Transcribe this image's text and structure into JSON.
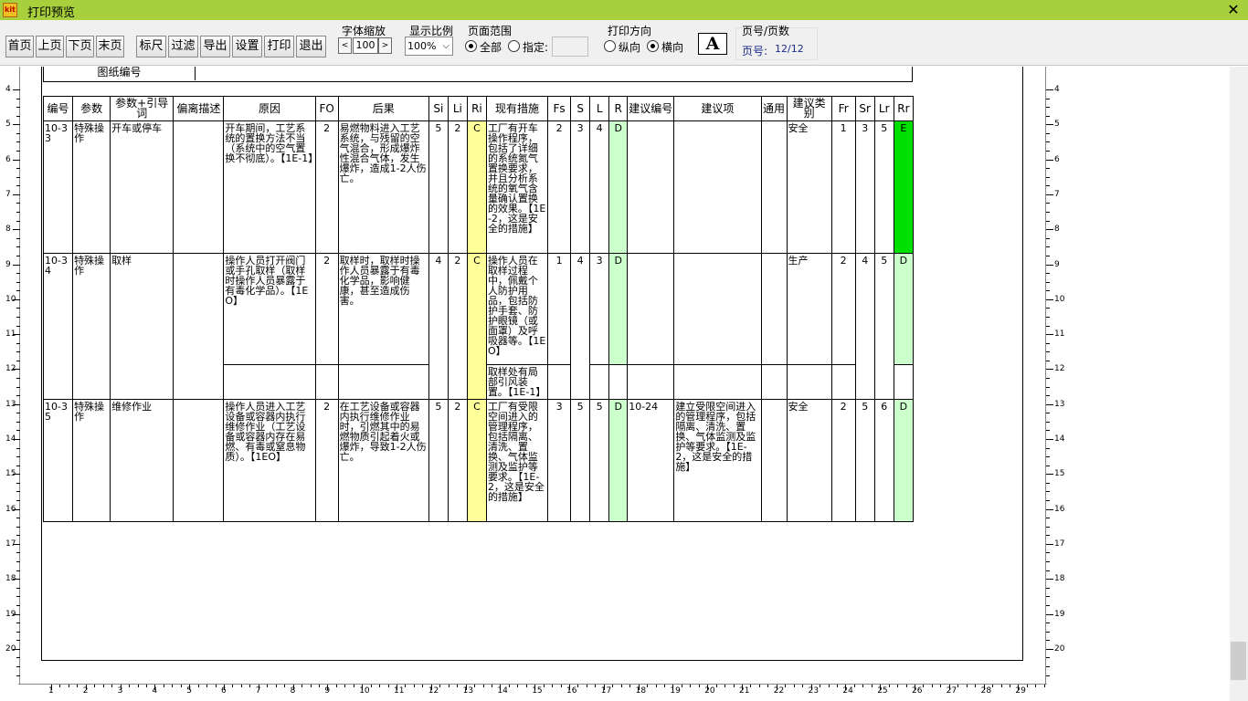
{
  "window": {
    "title": "打印预览",
    "close_glyph": "✕",
    "app_icon": "kit-app-icon"
  },
  "toolbar": {
    "first_page": "首页",
    "prev_page": "上页",
    "next_page": "下页",
    "last_page": "末页",
    "ruler": "标尺",
    "filter": "过滤",
    "export": "导出",
    "settings": "设置",
    "print": "打印",
    "exit": "退出",
    "font_scale_title": "字体缩放",
    "zoom_down": "<",
    "zoom_value": "100",
    "zoom_up": ">",
    "display_ratio_title": "显示比例",
    "display_ratio_value": "100%",
    "page_range_title": "页面范围",
    "range_all": "全部",
    "range_specify": "指定:",
    "range_all_selected": true,
    "orientation_title": "打印方向",
    "portrait": "纵向",
    "landscape": "横向",
    "landscape_selected": true,
    "font_icon_glyph": "A",
    "pages_title": "页号/页数",
    "page_no_label": "页号:",
    "page_no_value": "12/12"
  },
  "report": {
    "drawing_no_label": "图纸编号",
    "columns": [
      "编号",
      "参数",
      "参数+引导词",
      "偏离描述",
      "原因",
      "FO",
      "后果",
      "Si",
      "Li",
      "Ri",
      "现有措施",
      "Fs",
      "S",
      "L",
      "R",
      "建议编号",
      "建议项",
      "通用",
      "建议类别",
      "Fr",
      "Sr",
      "Lr",
      "Rr"
    ],
    "rows": [
      {
        "id": "10-33",
        "param": "特殊操作",
        "guide": "开车或停车",
        "deviation": "",
        "cause": "开车期间，工艺系统的置换方法不当（系统中的空气置换不彻底）。【1E-1】",
        "fo": "2",
        "consequence": "易燃物料进入工艺系统，与残留的空气混合，形成爆炸性混合气体，发生爆炸，造成1-2人伤亡。",
        "si": "5",
        "li": "2",
        "ri": "C",
        "measure": "工厂有开车操作程序，包括了详细的系统氮气置换要求，并且分析系统的氧气含量确认置换的效果。【1E-2，这是安全的措施】",
        "fs": "2",
        "s": "3",
        "l": "4",
        "r": "D",
        "rec_no": "",
        "rec": "",
        "general": "",
        "category": "安全",
        "fr": "1",
        "sr": "3",
        "lr": "5",
        "rr": "E"
      },
      {
        "id": "10-34",
        "param": "特殊操作",
        "guide": "取样",
        "deviation": "",
        "cause": "操作人员打开阀门或手孔取样（取样时操作人员暴露于有毒化学品）。【1EO】",
        "fo": "2",
        "consequence": "取样时，取样时操作人员暴露于有毒化学品，影响健康，甚至造成伤害。",
        "si": "4",
        "li": "2",
        "ri": "C",
        "measure": "操作人员在取样过程中，佩戴个人防护用品，包括防护手套、防护眼镜（或面罩）及呼吸器等。【1EO】",
        "measure2": "取样处有局部引风装置。【1E-1】",
        "fs": "1",
        "s": "4",
        "l": "3",
        "r": "D",
        "rec_no": "",
        "rec": "",
        "general": "",
        "category": "生产",
        "fr": "2",
        "sr": "4",
        "lr": "5",
        "rr": "D"
      },
      {
        "id": "10-35",
        "param": "特殊操作",
        "guide": "维修作业",
        "deviation": "",
        "cause": "操作人员进入工艺设备或容器内执行维修作业（工艺设备或容器内存在易燃、有毒或窒息物质）。【1EO】",
        "fo": "2",
        "consequence": "在工艺设备或容器内执行维修作业时，引燃其中的易燃物质引起着火或爆炸，导致1-2人伤亡。",
        "si": "5",
        "li": "2",
        "ri": "C",
        "measure": "工厂有受限空间进入的管理程序，包括隔离、清洗、置换、气体监测及监护等要求。【1E-2，这是安全的措施】",
        "fs": "3",
        "s": "5",
        "l": "5",
        "r": "D",
        "rec_no": "10-24",
        "rec": "建立受限空间进入的管理程序，包括隔离、清洗、置换、气体监测及监护等要求。【1E-2，这是安全的措施】",
        "general": "",
        "category": "安全",
        "fr": "2",
        "sr": "5",
        "lr": "6",
        "rr": "D"
      }
    ]
  },
  "rulers": {
    "vertical_labels": [
      "4",
      "5",
      "6",
      "7",
      "8",
      "9",
      "10",
      "11",
      "12",
      "13",
      "14",
      "15",
      "16",
      "17",
      "18",
      "19",
      "20"
    ],
    "horizontal_labels": [
      "1",
      "2",
      "3",
      "4",
      "5",
      "6",
      "7",
      "8",
      "9",
      "10",
      "11",
      "12",
      "13",
      "14",
      "15",
      "16",
      "17",
      "18",
      "19",
      "20",
      "21",
      "22",
      "23",
      "24",
      "25",
      "26",
      "27",
      "28",
      "29"
    ]
  },
  "colors": {
    "titlebar": "#a8cf3c",
    "risk_c": "#ffff99",
    "risk_d": "#ccffcc",
    "risk_e": "#00e000"
  }
}
